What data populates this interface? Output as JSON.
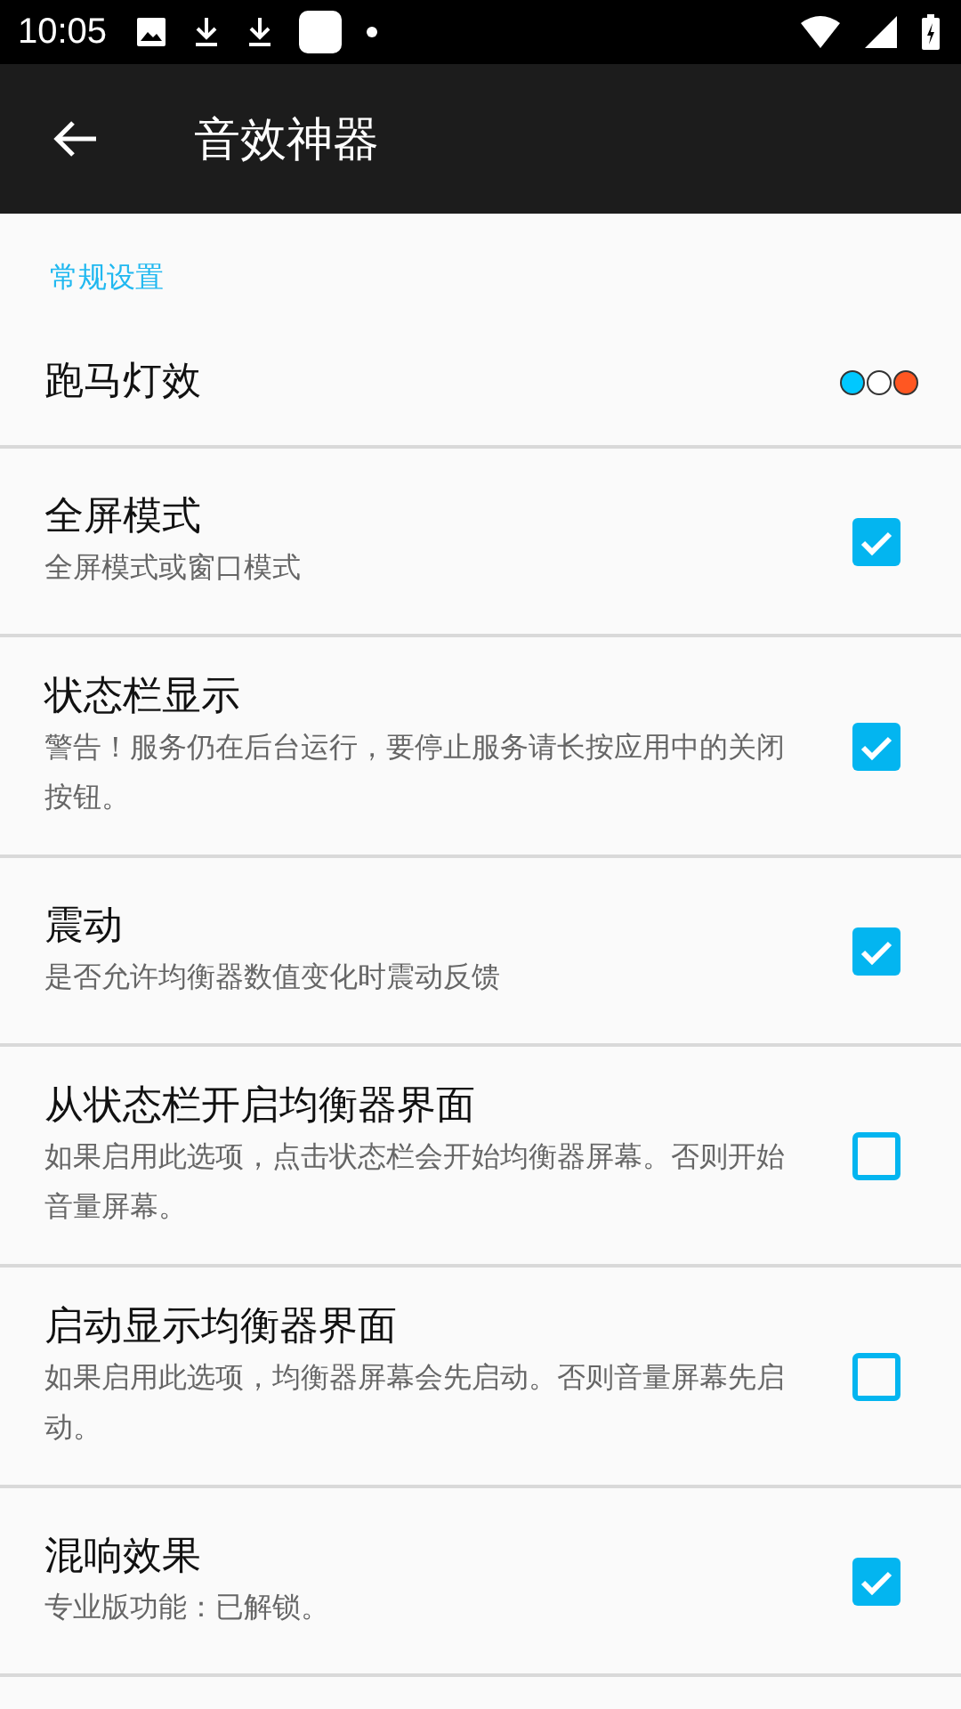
{
  "status_bar": {
    "time": "10:05"
  },
  "app_bar": {
    "title": "音效神器"
  },
  "section": {
    "title": "常规设置"
  },
  "settings": [
    {
      "kind": "colors",
      "title": "跑马灯效",
      "colors": [
        {
          "color": "#00c8ff"
        },
        {
          "color": "#ffffff"
        },
        {
          "color": "#ff5722"
        }
      ]
    },
    {
      "kind": "checkbox",
      "title": "全屏模式",
      "summary": "全屏模式或窗口模式",
      "checked": true
    },
    {
      "kind": "checkbox",
      "title": "状态栏显示",
      "summary": "警告！服务仍在后台运行，要停止服务请长按应用中的关闭按钮。",
      "checked": true
    },
    {
      "kind": "checkbox",
      "title": "震动",
      "summary": "是否允许均衡器数值变化时震动反馈",
      "checked": true
    },
    {
      "kind": "checkbox",
      "title": "从状态栏开启均衡器界面",
      "summary": "如果启用此选项，点击状态栏会开始均衡器屏幕。否则开始音量屏幕。",
      "checked": false
    },
    {
      "kind": "checkbox",
      "title": "启动显示均衡器界面",
      "summary": "如果启用此选项，均衡器屏幕会先启动。否则音量屏幕先启动。",
      "checked": false
    },
    {
      "kind": "checkbox",
      "title": "混响效果",
      "summary": "专业版功能：已解锁。",
      "checked": true
    }
  ]
}
